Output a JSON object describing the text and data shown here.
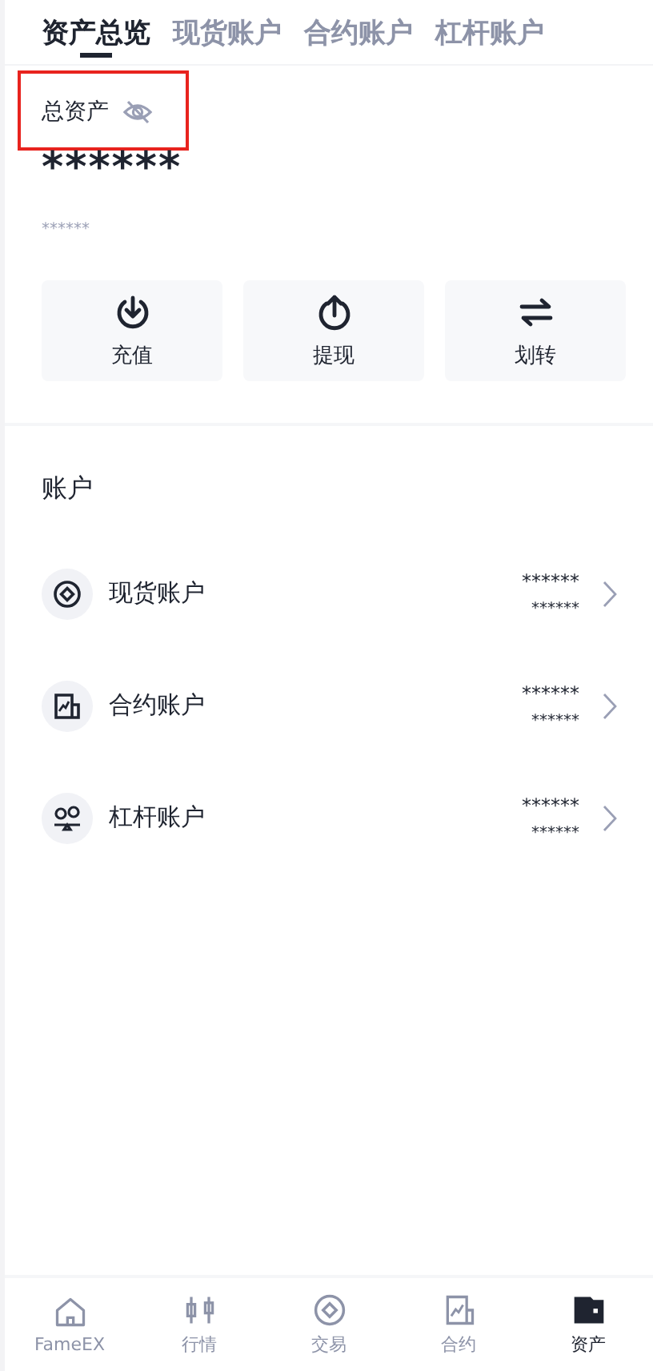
{
  "tabs": [
    {
      "label": "资产总览",
      "selected": true
    },
    {
      "label": "现货账户",
      "selected": false
    },
    {
      "label": "合约账户",
      "selected": false
    },
    {
      "label": "杠杆账户",
      "selected": false
    }
  ],
  "total": {
    "label": "总资产",
    "highlighted": true,
    "hidden": true,
    "value": "******",
    "sub_value": "******"
  },
  "actions": [
    {
      "kind": "deposit",
      "label": "充值"
    },
    {
      "kind": "withdraw",
      "label": "提现"
    },
    {
      "kind": "transfer",
      "label": "划转"
    }
  ],
  "accounts_title": "账户",
  "accounts": [
    {
      "kind": "spot",
      "name": "现货账户",
      "value": "******",
      "sub_value": "******"
    },
    {
      "kind": "contract",
      "name": "合约账户",
      "value": "******",
      "sub_value": "******"
    },
    {
      "kind": "margin",
      "name": "杠杆账户",
      "value": "******",
      "sub_value": "******"
    }
  ],
  "nav": [
    {
      "kind": "home",
      "label": "FameEX",
      "selected": false
    },
    {
      "kind": "market",
      "label": "行情",
      "selected": false
    },
    {
      "kind": "trade",
      "label": "交易",
      "selected": false
    },
    {
      "kind": "contract",
      "label": "合约",
      "selected": false
    },
    {
      "kind": "assets",
      "label": "资产",
      "selected": true
    }
  ]
}
